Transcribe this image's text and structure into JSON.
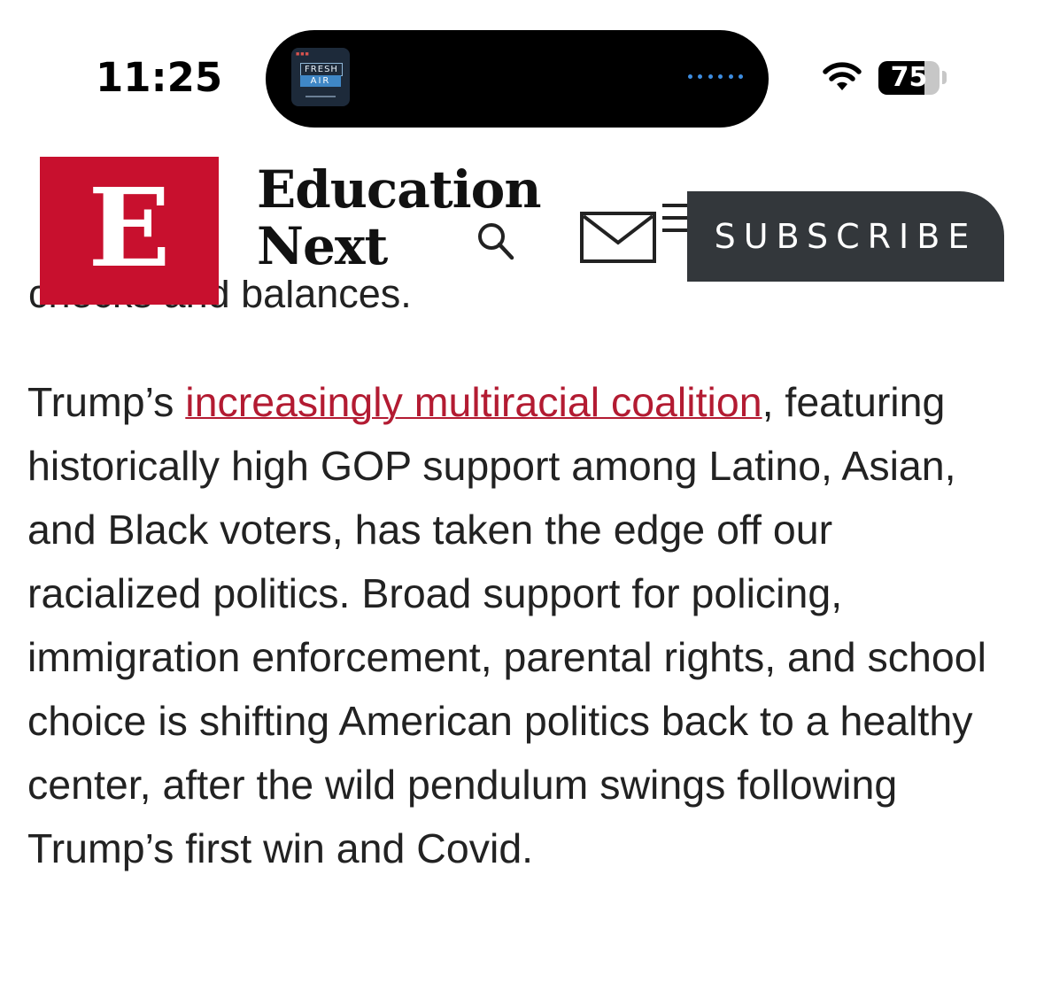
{
  "status_bar": {
    "time": "11:25",
    "now_playing": {
      "app_art_line1": "FRESH",
      "app_art_line2": "AIR",
      "art_icon": "fresh-air-podcast-art",
      "waveform_icon": "audio-waveform-icon",
      "waveform_color": "#3d8de0"
    },
    "wifi_icon": "wifi-icon",
    "battery_percent": 75,
    "battery_label": "75"
  },
  "header": {
    "logo_letter": "E",
    "logo_color": "#c8102e",
    "wordmark_line1": "Education",
    "wordmark_line2": "Next",
    "search_icon": "search-icon",
    "mail_icon": "envelope-icon",
    "menu_icon": "hamburger-menu-icon",
    "subscribe_label": "SUBSCRIBE",
    "subscribe_bg": "#33373b"
  },
  "article": {
    "cut_off_line": "checks and balances.",
    "paragraph_prefix": "Trump’s ",
    "link_text": "increasingly multiracial coalition",
    "link_color": "#b31b32",
    "paragraph_rest": ", featuring historically high GOP support among Latino, Asian, and Black voters, has taken the edge off our racialized politics. Broad support for policing, immigration enforcement, parental rights, and school choice is shifting American politics back to a healthy center, after the wild pendulum swings following Trump’s first win and Covid."
  }
}
